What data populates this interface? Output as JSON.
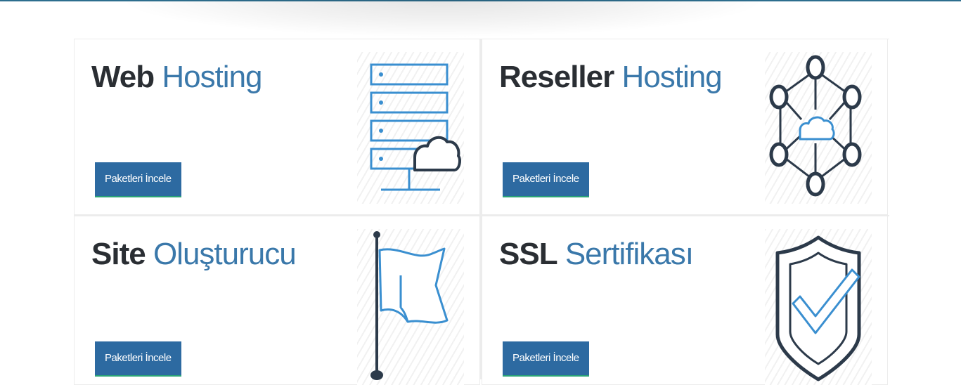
{
  "colors": {
    "accent": "#2d6aa1",
    "title_dark": "#2a2e33",
    "title_blue": "#3a78aa",
    "icon_dark": "#2c3a4a",
    "icon_blue": "#3a8fd0",
    "button_underline": "#2aa377"
  },
  "cards": [
    {
      "title_bold": "Web",
      "title_light": "Hosting",
      "button_label": "Paketleri İncele",
      "icon": "server-cloud-icon"
    },
    {
      "title_bold": "Reseller",
      "title_light": "Hosting",
      "button_label": "Paketleri İncele",
      "icon": "network-cloud-icon"
    },
    {
      "title_bold": "Site",
      "title_light": "Oluşturucu",
      "button_label": "Paketleri İncele",
      "icon": "flag-icon"
    },
    {
      "title_bold": "SSL",
      "title_light": "Sertifikası",
      "button_label": "Paketleri İncele",
      "icon": "shield-check-icon"
    }
  ]
}
